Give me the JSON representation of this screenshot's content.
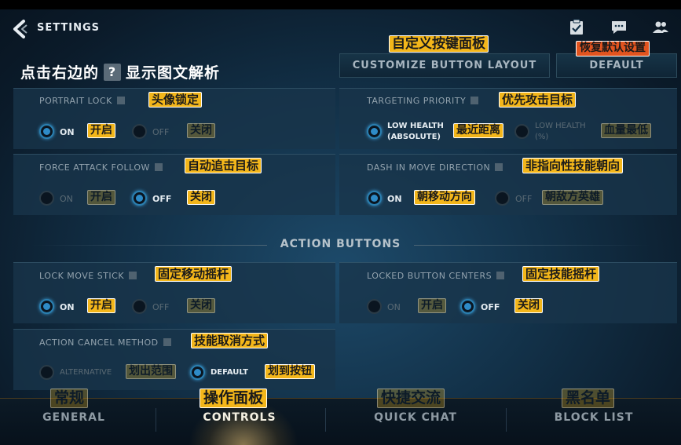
{
  "header": {
    "title": "SETTINGS",
    "hint_prefix": "点击右边的",
    "hint_q": "?",
    "hint_suffix": "显示图文解析"
  },
  "top_icons": [
    "checklist-icon",
    "chat-icon",
    "friends-icon"
  ],
  "customize": {
    "label": "CUSTOMIZE BUTTON LAYOUT",
    "cn": "自定义按键面板"
  },
  "default_btn": {
    "label": "DEFAULT",
    "cn": "恢复默认设置"
  },
  "panels": {
    "portrait_lock": {
      "title": "PORTRAIT LOCK",
      "cn": "头像锁定",
      "selected": "ON",
      "opt1": "ON",
      "opt1_cn": "开启",
      "opt2": "OFF",
      "opt2_cn": "关闭"
    },
    "targeting_priority": {
      "title": "TARGETING PRIORITY",
      "cn": "优先攻击目标",
      "selected": "LOW HEALTH (ABSOLUTE)",
      "opt1a": "LOW HEALTH",
      "opt1b": "(ABSOLUTE)",
      "opt1_cn": "最近距离",
      "opt2a": "LOW HEALTH",
      "opt2b": "(%)",
      "opt2_cn": "血量最低"
    },
    "force_attack_follow": {
      "title": "FORCE ATTACK FOLLOW",
      "cn": "自动追击目标",
      "selected": "OFF",
      "opt1": "ON",
      "opt1_cn": "开启",
      "opt2": "OFF",
      "opt2_cn": "关闭"
    },
    "dash_in_move_direction": {
      "title": "DASH IN MOVE DIRECTION",
      "cn": "非指向性技能朝向",
      "selected": "ON",
      "opt1": "ON",
      "opt1_cn": "朝移动方向",
      "opt2": "OFF",
      "opt2_cn": "朝敌方英雄"
    },
    "lock_move_stick": {
      "title": "LOCK MOVE STICK",
      "cn": "固定移动摇杆",
      "selected": "ON",
      "opt1": "ON",
      "opt1_cn": "开启",
      "opt2": "OFF",
      "opt2_cn": "关闭"
    },
    "locked_button_centers": {
      "title": "LOCKED BUTTON CENTERS",
      "cn": "固定技能摇杆",
      "selected": "OFF",
      "opt1": "ON",
      "opt1_cn": "开启",
      "opt2": "OFF",
      "opt2_cn": "关闭"
    },
    "action_cancel_method": {
      "title": "ACTION CANCEL METHOD",
      "cn": "技能取消方式",
      "selected": "DEFAULT",
      "opt1": "ALTERNATIVE",
      "opt1_cn": "划出范围",
      "opt2": "DEFAULT",
      "opt2_cn": "划到按钮"
    }
  },
  "section": {
    "title": "ACTION BUTTONS"
  },
  "bottom_tabs": [
    {
      "label": "GENERAL",
      "cn": "常规",
      "active": false
    },
    {
      "label": "CONTROLS",
      "cn": "操作面板",
      "active": true
    },
    {
      "label": "QUICK CHAT",
      "cn": "快捷交流",
      "active": false
    },
    {
      "label": "BLOCK LIST",
      "cn": "黑名单",
      "active": false
    }
  ],
  "colors": {
    "accent": "#2e8bc7",
    "label_bg": "#f3b61a",
    "default_label_bg": "#e2541f",
    "background": "#123047"
  }
}
